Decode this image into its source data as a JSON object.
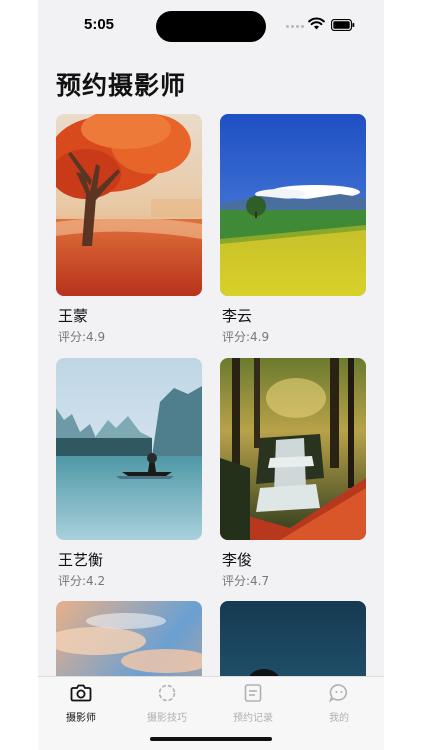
{
  "status_bar": {
    "time": "5:05"
  },
  "page": {
    "title": "预约摄影师"
  },
  "photographers": [
    {
      "name": "王蒙",
      "rating": "评分:4.9",
      "photo": "autumn-tree"
    },
    {
      "name": "李云",
      "rating": "评分:4.9",
      "photo": "rapeseed-field"
    },
    {
      "name": "王艺衡",
      "rating": "评分:4.2",
      "photo": "lake-boat"
    },
    {
      "name": "李俊",
      "rating": "评分:4.7",
      "photo": "forest-waterfall"
    },
    {
      "name": "",
      "rating": "",
      "photo": "sunset-sky"
    },
    {
      "name": "",
      "rating": "",
      "photo": "night-sea"
    }
  ],
  "tabs": [
    {
      "label": "摄影师",
      "icon": "camera-icon",
      "active": true
    },
    {
      "label": "摄影技巧",
      "icon": "aperture-icon",
      "active": false
    },
    {
      "label": "预约记录",
      "icon": "list-icon",
      "active": false
    },
    {
      "label": "我的",
      "icon": "chat-bubble-icon",
      "active": false
    }
  ],
  "colors": {
    "active_tab": "#111111",
    "inactive_tab": "#b0b0b4",
    "background": "#f2f2f4"
  }
}
